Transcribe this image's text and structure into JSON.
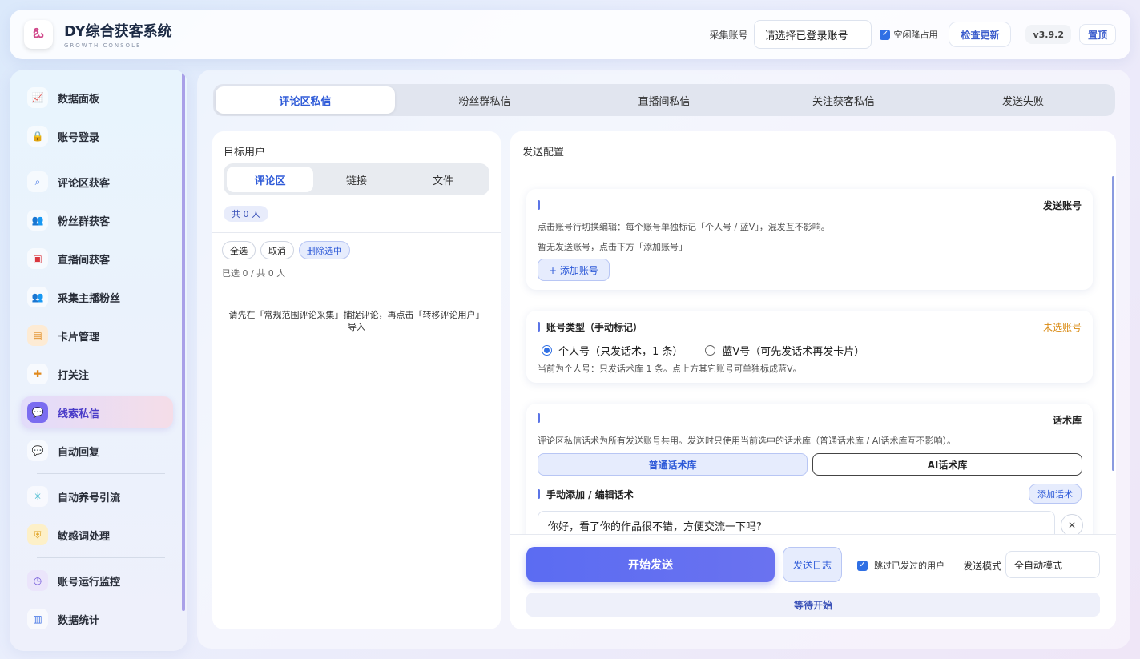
{
  "app": {
    "title": "DY综合获客系统",
    "subtitle": "GROWTH CONSOLE"
  },
  "topbar": {
    "account_label": "采集账号",
    "account_value": "请选择已登录账号",
    "idle_label": "空闲降占用",
    "idle_checked": true,
    "check_update": "检查更新",
    "version": "v3.9.2",
    "pin_top": "置顶"
  },
  "sidebar": {
    "items": [
      {
        "label": "数据面板",
        "icon": "chart-line-icon",
        "glyph": "📈"
      },
      {
        "label": "账号登录",
        "icon": "lock-icon",
        "glyph": "🔒"
      },
      {
        "label": "评论区获客",
        "icon": "search-icon",
        "glyph": "⌕"
      },
      {
        "label": "粉丝群获客",
        "icon": "users-icon",
        "glyph": "👥"
      },
      {
        "label": "直播间获客",
        "icon": "monitor-icon",
        "glyph": "▣"
      },
      {
        "label": "采集主播粉丝",
        "icon": "user-group-icon",
        "glyph": "👥"
      },
      {
        "label": "卡片管理",
        "icon": "card-icon",
        "glyph": "▤"
      },
      {
        "label": "打关注",
        "icon": "user-plus-icon",
        "glyph": "✚"
      },
      {
        "label": "线索私信",
        "icon": "message-icon",
        "glyph": "💬"
      },
      {
        "label": "自动回复",
        "icon": "chat-reply-icon",
        "glyph": "💬"
      },
      {
        "label": "自动养号引流",
        "icon": "loader-icon",
        "glyph": "✳"
      },
      {
        "label": "敏感词处理",
        "icon": "shield-icon",
        "glyph": "⛨"
      },
      {
        "label": "账号运行监控",
        "icon": "clock-icon",
        "glyph": "◷"
      },
      {
        "label": "数据统计",
        "icon": "bar-chart-icon",
        "glyph": "▥"
      }
    ],
    "active": "线索私信",
    "colors": {
      "active_icon_bg": "#7b6cf0"
    }
  },
  "tabs": [
    {
      "label": "评论区私信"
    },
    {
      "label": "粉丝群私信"
    },
    {
      "label": "直播间私信"
    },
    {
      "label": "关注获客私信"
    },
    {
      "label": "发送失败"
    }
  ],
  "left": {
    "title": "目标用户",
    "segments": [
      {
        "label": "评论区"
      },
      {
        "label": "链接"
      },
      {
        "label": "文件"
      }
    ],
    "count": "共 0 人",
    "buttons": {
      "select_all": "全选",
      "cancel": "取消",
      "delete_selected": "删除选中"
    },
    "selected_info": "已选 0 / 共 0 人",
    "hint": "请先在「常规范围评论采集」捕捉评论，再点击「转移评论用户」导入"
  },
  "right": {
    "title": "发送配置",
    "send_accounts": {
      "heading": "发送账号",
      "desc": "点击账号行切换编辑：每个账号单独标记「个人号 / 蓝V」，混发互不影响。",
      "empty": "暂无发送账号，点击下方「添加账号」",
      "add": "+ 添加账号"
    },
    "account_type": {
      "heading": "账号类型（手动标记）",
      "status": "未选账号",
      "opt_personal": "个人号（只发话术，1 条）",
      "opt_bluev": "蓝V号（可先发话术再发卡片）",
      "note": "当前为个人号：只发话术库 1 条。点上方其它账号可单独标成蓝V。"
    },
    "script_lib": {
      "heading": "话术库",
      "desc": "评论区私信话术为所有发送账号共用。发送时只使用当前选中的话术库（普通话术库 / AI话术库互不影响）。",
      "normal": "普通话术库",
      "ai": "AI话术库",
      "manual_heading": "手动添加 / 编辑话术",
      "add_script": "添加话术",
      "script_text": "你好，看了你的作品很不错，方便交流一下吗?"
    },
    "bottom": {
      "start": "开始发送",
      "log": "发送日志",
      "skip_sent": "跳过已发过的用户",
      "mode_label": "发送模式",
      "mode_value": "全自动模式",
      "status": "等待开始"
    }
  }
}
